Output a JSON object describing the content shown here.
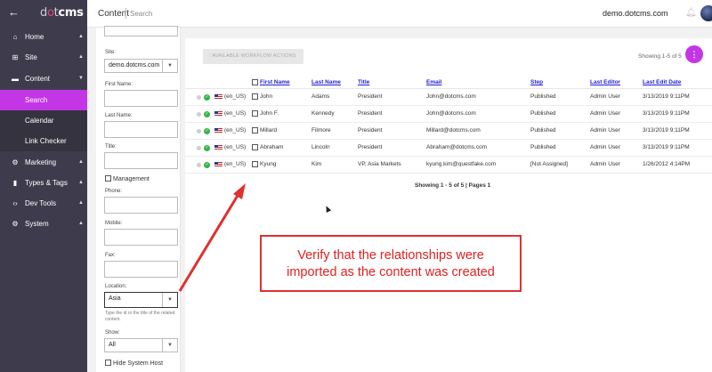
{
  "topbar": {
    "logo_dot": "d",
    "logo_o": "o",
    "logo_t": "t",
    "logo_cms": "cms",
    "section": "Content",
    "subsection": "Search",
    "site": "demo.dotcms.com"
  },
  "sidebar": {
    "items": [
      {
        "icon": "home-icon",
        "label": "Home"
      },
      {
        "icon": "sitemap-icon",
        "label": "Site"
      },
      {
        "icon": "folder-icon",
        "label": "Content"
      },
      {
        "icon": "gear-icon",
        "label": "Marketing"
      },
      {
        "icon": "file-icon",
        "label": "Types & Tags"
      },
      {
        "icon": "code-icon",
        "label": "Dev Tools"
      },
      {
        "icon": "gear-icon",
        "label": "System"
      }
    ],
    "sub_items": [
      {
        "label": "Search"
      },
      {
        "label": "Calendar"
      },
      {
        "label": "Link Checker"
      }
    ]
  },
  "filters": {
    "site_label": "Site:",
    "site_value": "demo.dotcms.com",
    "first_name_label": "First Name:",
    "last_name_label": "Last Name:",
    "title_label": "Title:",
    "management_label": "Management",
    "phone_label": "Phone:",
    "mobile_label": "Mobile:",
    "fax_label": "Fax:",
    "location_label": "Location:",
    "location_value": "Asia",
    "location_help": "Type the id or the title of the related content.",
    "show_label": "Show:",
    "show_value": "All",
    "hide_system_host_label": "Hide System Host"
  },
  "main": {
    "workflow_button": "AVAILABLE WORKFLOW ACTIONS",
    "showing_top": "Showing 1-5 of 5",
    "fab_label": "⋮",
    "columns": {
      "first_name": "First Name",
      "last_name": "Last Name",
      "title": "Title",
      "email": "Email",
      "step": "Step",
      "last_editor": "Last Editor",
      "last_edit_date": "Last Edit Date"
    },
    "rows": [
      {
        "lang": "(en_US)",
        "first": "John",
        "last": "Adams",
        "title": "President",
        "email": "John@dotcms.com",
        "step": "Published",
        "editor": "Admin User",
        "date": "3/13/2019 9:11PM"
      },
      {
        "lang": "(en_US)",
        "first": "John F.",
        "last": "Kennedy",
        "title": "President",
        "email": "John@dotcms.com",
        "step": "Published",
        "editor": "Admin User",
        "date": "3/13/2019 9:11PM"
      },
      {
        "lang": "(en_US)",
        "first": "Millard",
        "last": "Filmore",
        "title": "President",
        "email": "Millard@dotcms.com",
        "step": "Published",
        "editor": "Admin User",
        "date": "3/13/2019 9:11PM"
      },
      {
        "lang": "(en_US)",
        "first": "Abraham",
        "last": "Lincoln",
        "title": "President",
        "email": "Abraham@dotcms.com",
        "step": "Published",
        "editor": "Admin User",
        "date": "3/13/2019 9:11PM"
      },
      {
        "lang": "(en_US)",
        "first": "Kyung",
        "last": "Kim",
        "title": "VP, Asia Markets",
        "email": "kyung.kim@questfake.com",
        "step": "[Not Assigned]",
        "editor": "Admin User",
        "date": "1/26/2012 4:14PM"
      }
    ],
    "showing_bottom": "Showing 1 - 5 of 5 | Pages 1"
  },
  "annotation": {
    "line1": "Verify that the relationships were",
    "line2": "imported as the content was created",
    "color": "#e02020"
  },
  "colors": {
    "sidebar": "#3e3c4c",
    "accent": "#c336e5",
    "link": "#1f1fd4",
    "status_green": "#37b34a"
  }
}
